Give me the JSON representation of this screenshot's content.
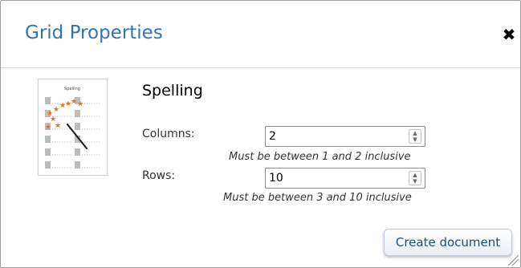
{
  "dialog": {
    "title": "Grid Properties",
    "close_icon": "close-icon",
    "close_glyph": "✖"
  },
  "document": {
    "name": "Spelling",
    "thumbnail_label": "Spelling"
  },
  "form": {
    "columns": {
      "label": "Columns:",
      "value": "2",
      "hint": "Must be between 1 and 2 inclusive"
    },
    "rows": {
      "label": "Rows:",
      "value": "10",
      "hint": "Must be between 3 and 10 inclusive"
    }
  },
  "actions": {
    "create_label": "Create document"
  },
  "colors": {
    "title": "#2f74b5",
    "button_text": "#1f4e79",
    "star": "#f26b1d"
  }
}
